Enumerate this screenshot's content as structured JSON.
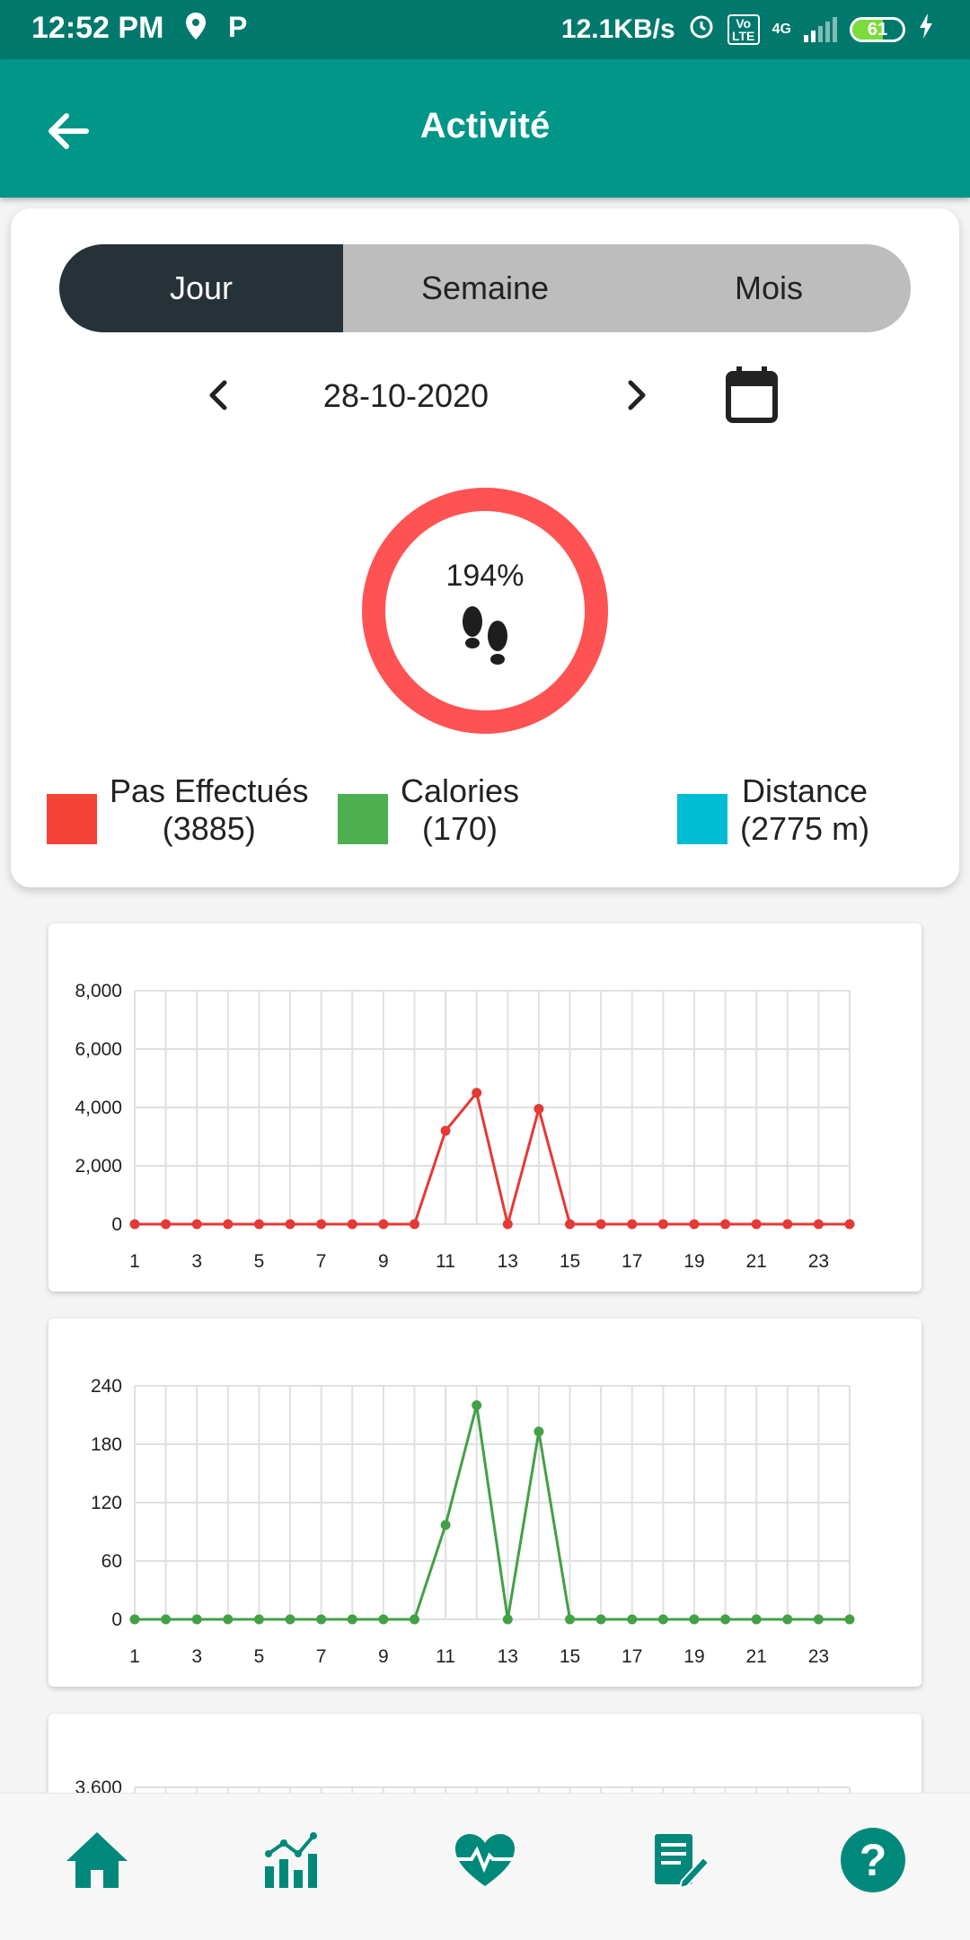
{
  "status_bar": {
    "time": "12:52 PM",
    "left_icons": [
      "location-icon",
      "p-icon"
    ],
    "speed": "12.1KB/s",
    "network": "4G",
    "volte": "Vo LTE",
    "battery": "61",
    "battery_level": 0.61
  },
  "app_bar": {
    "title": "Activité",
    "back_icon": "arrow-back-icon"
  },
  "period_tabs": [
    {
      "label": "Jour",
      "active": true
    },
    {
      "label": "Semaine",
      "active": false
    },
    {
      "label": "Mois",
      "active": false
    }
  ],
  "date": "28-10-2020",
  "progress": {
    "percent_label": "194%",
    "value": 1.94,
    "color": "#ff5252",
    "icon": "footsteps-icon"
  },
  "legend": [
    {
      "label": "Pas Effectués",
      "value": "(3885)",
      "color": "#f44336"
    },
    {
      "label": "Calories",
      "value": "(170)",
      "color": "#4caf50"
    },
    {
      "label": "Distance",
      "value": "(2775 m)",
      "color": "#00bcd4"
    }
  ],
  "chart_data": [
    {
      "type": "line",
      "color": "#e53935",
      "x": [
        1,
        2,
        3,
        4,
        5,
        6,
        7,
        8,
        9,
        10,
        11,
        12,
        13,
        14,
        15,
        16,
        17,
        18,
        19,
        20,
        21,
        22,
        23,
        24
      ],
      "values": [
        0,
        0,
        0,
        0,
        0,
        0,
        0,
        0,
        0,
        0,
        3200,
        4500,
        0,
        3950,
        0,
        0,
        0,
        0,
        0,
        0,
        0,
        0,
        0,
        0
      ],
      "xticks": [
        1,
        3,
        5,
        7,
        9,
        11,
        13,
        15,
        17,
        19,
        21,
        23
      ],
      "yticks": [
        "0",
        "2,000",
        "4,000",
        "6,000",
        "8,000"
      ],
      "ylim": [
        0,
        8000
      ],
      "grid": true
    },
    {
      "type": "line",
      "color": "#43a047",
      "x": [
        1,
        2,
        3,
        4,
        5,
        6,
        7,
        8,
        9,
        10,
        11,
        12,
        13,
        14,
        15,
        16,
        17,
        18,
        19,
        20,
        21,
        22,
        23,
        24
      ],
      "values": [
        0,
        0,
        0,
        0,
        0,
        0,
        0,
        0,
        0,
        0,
        97,
        220,
        0,
        193,
        0,
        0,
        0,
        0,
        0,
        0,
        0,
        0,
        0,
        0
      ],
      "xticks": [
        1,
        3,
        5,
        7,
        9,
        11,
        13,
        15,
        17,
        19,
        21,
        23
      ],
      "yticks": [
        "0",
        "60",
        "120",
        "180",
        "240"
      ],
      "ylim": [
        0,
        240
      ],
      "grid": true
    },
    {
      "type": "line",
      "color": "#00bcd4",
      "visible_ytick": "3,600",
      "grid": true
    }
  ],
  "bottom_nav": [
    {
      "icon": "home-icon"
    },
    {
      "icon": "stats-chart-icon"
    },
    {
      "icon": "heart-pulse-icon"
    },
    {
      "icon": "notes-edit-icon"
    },
    {
      "icon": "help-icon"
    }
  ]
}
